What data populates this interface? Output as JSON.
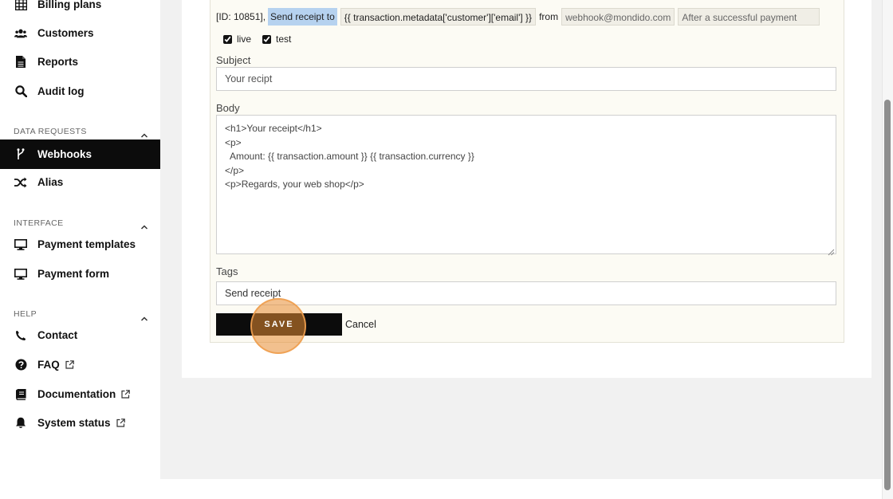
{
  "sidebar": {
    "top_items": [
      {
        "label": "Billing plans",
        "icon": "table-icon"
      },
      {
        "label": "Customers",
        "icon": "users-icon"
      },
      {
        "label": "Reports",
        "icon": "file-icon"
      },
      {
        "label": "Audit log",
        "icon": "search-icon"
      }
    ],
    "sections": [
      {
        "title": "DATA REQUESTS",
        "items": [
          {
            "label": "Webhooks",
            "icon": "branch-icon",
            "active": true
          },
          {
            "label": "Alias",
            "icon": "shuffle-icon"
          }
        ]
      },
      {
        "title": "INTERFACE",
        "items": [
          {
            "label": "Payment templates",
            "icon": "monitor-icon"
          },
          {
            "label": "Payment form",
            "icon": "monitor-icon"
          }
        ]
      },
      {
        "title": "HELP",
        "items": [
          {
            "label": "Contact",
            "icon": "phone-icon"
          },
          {
            "label": "FAQ",
            "icon": "question-icon",
            "external": true
          },
          {
            "label": "Documentation",
            "icon": "book-icon",
            "external": true
          },
          {
            "label": "System status",
            "icon": "bell-icon",
            "external": true
          }
        ]
      }
    ]
  },
  "webhook": {
    "id_text": "[ID: 10851],",
    "action": "Send receipt to",
    "recipient": "{{ transaction.metadata['customer']['email'] }}",
    "from_word": "from",
    "sender": "webhook@mondido.com",
    "trigger": "After a successful payment",
    "live_label": "live",
    "test_label": "test"
  },
  "form": {
    "subject_label": "Subject",
    "subject_value": "Your recipt",
    "body_label": "Body",
    "body_value": "<h1>Your receipt</h1>\n<p>\n  Amount: {{ transaction.amount }} {{ transaction.currency }}\n</p>\n<p>Regards, your web shop</p>",
    "tags_label": "Tags",
    "tags_value": "Send receipt",
    "save_label": "SAVE",
    "cancel_label": "Cancel"
  },
  "colors": {
    "accent": "#0c0c0c",
    "highlight": "#b6d2ef",
    "click_marker": "#e88c32"
  }
}
